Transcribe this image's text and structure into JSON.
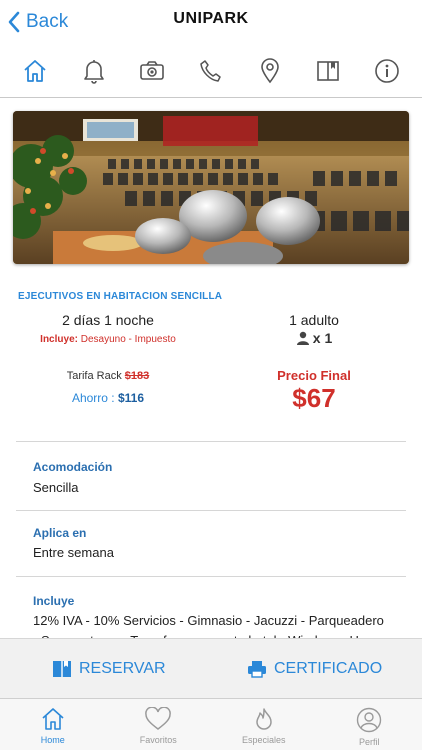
{
  "nav": {
    "back_label": "Back",
    "title": "UNIPARK"
  },
  "toolbar": {
    "icons": [
      "home-icon",
      "bell-icon",
      "camera-icon",
      "phone-icon",
      "location-pin-icon",
      "book-icon",
      "info-icon"
    ],
    "active_color": "#2b88d8",
    "icon_color": "#555555"
  },
  "offer": {
    "title": "EJECUTIVOS EN HABITACION SENCILLA",
    "duration": "2 días 1 noche",
    "includes_label": "Incluye:",
    "includes_value": "Desayuno - Impuesto",
    "adults": "1 adulto",
    "people_count": "x 1",
    "rack_label": "Tarifa Rack",
    "rack_price": "$183",
    "savings_label": "Ahorro :",
    "savings_value": "$116",
    "final_label": "Precio Final",
    "final_price": "$67"
  },
  "details": {
    "accommodation_label": "Acomodación",
    "accommodation_value": "Sencilla",
    "applies_label": "Aplica en",
    "applies_value": "Entre semana",
    "includes_label": "Incluye",
    "includes_line1": "12% IVA - 10% Servicios - Gimnasio - Jacuzzi - Parqueadero",
    "includes_line2": "- Sauna - turco - Transfer aeropuerto hotel - Wireless - Hora"
  },
  "actions": {
    "reserve_label": "RESERVAR",
    "certificate_label": "CERTIFICADO"
  },
  "tabs": [
    {
      "label": "Home",
      "icon": "home-icon"
    },
    {
      "label": "Favoritos",
      "icon": "heart-icon"
    },
    {
      "label": "Especiales",
      "icon": "flame-icon"
    },
    {
      "label": "Perfil",
      "icon": "user-icon"
    }
  ],
  "colors": {
    "accent": "#2b88d8",
    "price_red": "#d0302b"
  }
}
